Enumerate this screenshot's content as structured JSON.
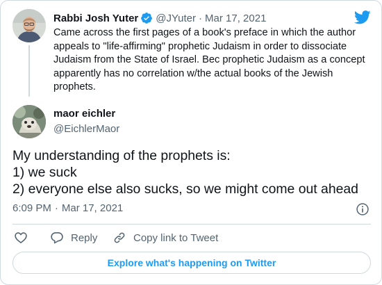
{
  "parent_tweet": {
    "author_name": "Rabbi Josh Yuter",
    "handle": "@JYuter",
    "separator": "·",
    "date": "Mar 17, 2021",
    "text": "Came across the first pages of a book's preface in which the author appeals to \"life-affirming\" prophetic Judaism in order to dissociate Judaism from the State of Israel. Bec prophetic Judaism as a concept apparently has no correlation w/the actual books of the Jewish prophets."
  },
  "main_tweet": {
    "author_name": "maor eichler",
    "handle": "@EichlerMaor",
    "text_lines": [
      "My understanding of the prophets is:",
      "1) we suck",
      "2) everyone else also sucks, so we might come out ahead"
    ],
    "time": "6:09 PM",
    "separator": "·",
    "date": "Mar 17, 2021"
  },
  "actions": {
    "reply_label": "Reply",
    "copy_link_label": "Copy link to Tweet"
  },
  "explore_label": "Explore what's happening on Twitter",
  "icons": {
    "brand": "twitter-bird-icon",
    "verified": "verified-badge-icon",
    "info": "info-icon",
    "like": "heart-icon",
    "reply": "speech-bubble-icon",
    "copy_link": "link-icon"
  },
  "colors": {
    "brand_blue": "#1d9bf0",
    "text_primary": "#0f1419",
    "text_secondary": "#536471",
    "border": "#cfd9de"
  }
}
